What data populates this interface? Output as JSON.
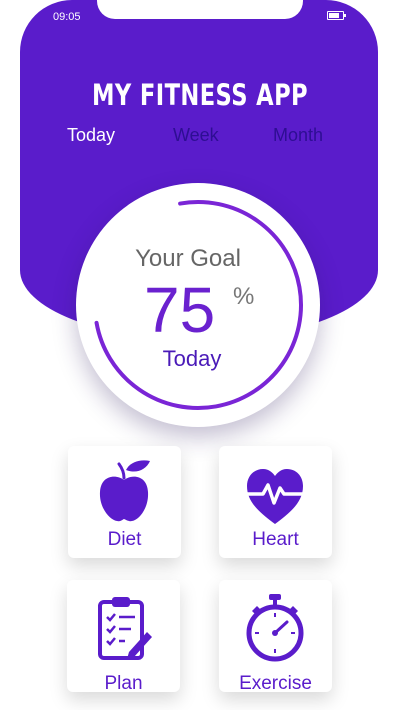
{
  "status_bar": {
    "time": "09:05"
  },
  "app": {
    "title": "MY FITNESS APP"
  },
  "tabs": [
    {
      "label": "Today",
      "active": true
    },
    {
      "label": "Week",
      "active": false
    },
    {
      "label": "Month",
      "active": false
    }
  ],
  "goal": {
    "label": "Your Goal",
    "value": "75",
    "unit": "%",
    "period": "Today",
    "progress_percent": 75
  },
  "cards": [
    {
      "label": "Diet",
      "icon": "apple-icon"
    },
    {
      "label": "Heart",
      "icon": "heart-pulse-icon"
    },
    {
      "label": "Plan",
      "icon": "clipboard-icon"
    },
    {
      "label": "Exercise",
      "icon": "stopwatch-icon"
    }
  ],
  "colors": {
    "primary": "#5a1ccb",
    "tab_inactive": "#2e0e93",
    "goal_value": "#6a21cf",
    "ring": "#7a25d6"
  }
}
